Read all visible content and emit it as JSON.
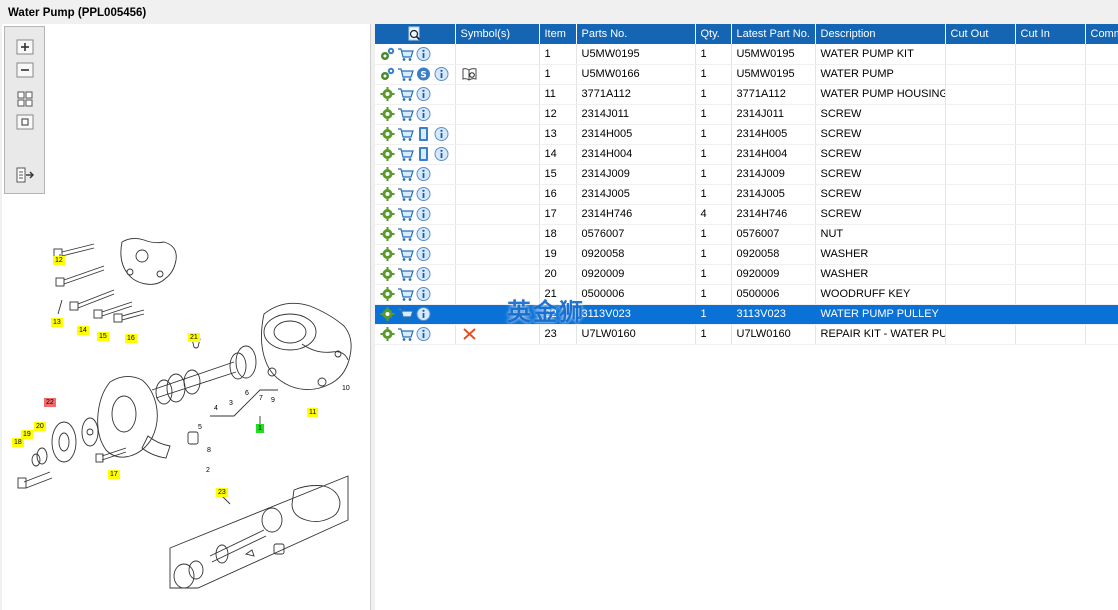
{
  "window": {
    "title": "Water Pump (PPL005456)"
  },
  "toolbar": {
    "buttons": [
      "zoom-in-icon",
      "zoom-out-icon",
      "fit-all-icon",
      "actual-size-icon",
      "export-icon"
    ]
  },
  "diagram": {
    "callouts": [
      {
        "text": "12",
        "style": "yellow"
      },
      {
        "text": "13",
        "style": "yellow"
      },
      {
        "text": "14",
        "style": "yellow"
      },
      {
        "text": "15",
        "style": "yellow"
      },
      {
        "text": "16",
        "style": "yellow"
      },
      {
        "text": "21",
        "style": "yellow"
      },
      {
        "text": "22",
        "style": "red"
      },
      {
        "text": "20",
        "style": "yellow"
      },
      {
        "text": "19",
        "style": "yellow"
      },
      {
        "text": "18",
        "style": "yellow"
      },
      {
        "text": "17",
        "style": "yellow"
      },
      {
        "text": "1",
        "style": "green"
      },
      {
        "text": "11",
        "style": "yellow"
      },
      {
        "text": "23",
        "style": "yellow"
      }
    ],
    "plain_numbers": [
      "10",
      "9",
      "7",
      "6",
      "3",
      "4",
      "5",
      "8",
      "2"
    ]
  },
  "table": {
    "columns": [
      "",
      "Symbol(s)",
      "Item",
      "Parts No.",
      "Qty.",
      "Latest Part No.",
      "Description",
      "Cut Out",
      "Cut In",
      "Comment"
    ],
    "rows": [
      {
        "icons": [
          "gears",
          "cart",
          "info"
        ],
        "symbol": "",
        "item": "1",
        "part": "U5MW0195",
        "qty": "1",
        "latest": "U5MW0195",
        "desc": "WATER PUMP KIT",
        "cut_out": "",
        "cut_in": "",
        "comment": "",
        "selected": false
      },
      {
        "icons": [
          "gears",
          "cart",
          "s",
          "info"
        ],
        "symbol": "book",
        "item": "1",
        "part": "U5MW0166",
        "qty": "1",
        "latest": "U5MW0195",
        "desc": "WATER PUMP",
        "cut_out": "",
        "cut_in": "",
        "comment": "",
        "selected": false
      },
      {
        "icons": [
          "gear",
          "cart",
          "info"
        ],
        "symbol": "",
        "item": "11",
        "part": "3771A112",
        "qty": "1",
        "latest": "3771A112",
        "desc": "WATER PUMP HOUSING",
        "cut_out": "",
        "cut_in": "",
        "comment": "",
        "selected": false
      },
      {
        "icons": [
          "gear",
          "cart",
          "info"
        ],
        "symbol": "",
        "item": "12",
        "part": "2314J011",
        "qty": "1",
        "latest": "2314J011",
        "desc": "SCREW",
        "cut_out": "",
        "cut_in": "",
        "comment": "",
        "selected": false
      },
      {
        "icons": [
          "gear",
          "cart",
          "doc",
          "info"
        ],
        "symbol": "",
        "item": "13",
        "part": "2314H005",
        "qty": "1",
        "latest": "2314H005",
        "desc": "SCREW",
        "cut_out": "",
        "cut_in": "",
        "comment": "",
        "selected": false
      },
      {
        "icons": [
          "gear",
          "cart",
          "doc",
          "info"
        ],
        "symbol": "",
        "item": "14",
        "part": "2314H004",
        "qty": "1",
        "latest": "2314H004",
        "desc": "SCREW",
        "cut_out": "",
        "cut_in": "",
        "comment": "",
        "selected": false
      },
      {
        "icons": [
          "gear",
          "cart",
          "info"
        ],
        "symbol": "",
        "item": "15",
        "part": "2314J009",
        "qty": "1",
        "latest": "2314J009",
        "desc": "SCREW",
        "cut_out": "",
        "cut_in": "",
        "comment": "",
        "selected": false
      },
      {
        "icons": [
          "gear",
          "cart",
          "info"
        ],
        "symbol": "",
        "item": "16",
        "part": "2314J005",
        "qty": "1",
        "latest": "2314J005",
        "desc": "SCREW",
        "cut_out": "",
        "cut_in": "",
        "comment": "",
        "selected": false
      },
      {
        "icons": [
          "gear",
          "cart",
          "info"
        ],
        "symbol": "",
        "item": "17",
        "part": "2314H746",
        "qty": "4",
        "latest": "2314H746",
        "desc": "SCREW",
        "cut_out": "",
        "cut_in": "",
        "comment": "",
        "selected": false
      },
      {
        "icons": [
          "gear",
          "cart",
          "info"
        ],
        "symbol": "",
        "item": "18",
        "part": "0576007",
        "qty": "1",
        "latest": "0576007",
        "desc": "NUT",
        "cut_out": "",
        "cut_in": "",
        "comment": "",
        "selected": false
      },
      {
        "icons": [
          "gear",
          "cart",
          "info"
        ],
        "symbol": "",
        "item": "19",
        "part": "0920058",
        "qty": "1",
        "latest": "0920058",
        "desc": "WASHER",
        "cut_out": "",
        "cut_in": "",
        "comment": "",
        "selected": false
      },
      {
        "icons": [
          "gear",
          "cart",
          "info"
        ],
        "symbol": "",
        "item": "20",
        "part": "0920009",
        "qty": "1",
        "latest": "0920009",
        "desc": "WASHER",
        "cut_out": "",
        "cut_in": "",
        "comment": "",
        "selected": false
      },
      {
        "icons": [
          "gear",
          "cart",
          "info"
        ],
        "symbol": "",
        "item": "21",
        "part": "0500006",
        "qty": "1",
        "latest": "0500006",
        "desc": "WOODRUFF KEY",
        "cut_out": "",
        "cut_in": "",
        "comment": "",
        "selected": false
      },
      {
        "icons": [
          "gear",
          "cart",
          "info"
        ],
        "symbol": "",
        "item": "22",
        "part": "3113V023",
        "qty": "1",
        "latest": "3113V023",
        "desc": "WATER PUMP PULLEY",
        "cut_out": "",
        "cut_in": "",
        "comment": "",
        "selected": true
      },
      {
        "icons": [
          "gear",
          "cart",
          "info"
        ],
        "symbol": "cross",
        "item": "23",
        "part": "U7LW0160",
        "qty": "1",
        "latest": "U7LW0160",
        "desc": "REPAIR KIT - WATER PUMP",
        "cut_out": "",
        "cut_in": "",
        "comment": "",
        "selected": false
      }
    ]
  },
  "watermark": {
    "text": "英金狮"
  },
  "colors": {
    "header": "#1565b5",
    "selected_row": "#0a72d6",
    "callout": "#ffff00",
    "callout_active": "#f26b6b",
    "callout_group": "#22dd22"
  }
}
